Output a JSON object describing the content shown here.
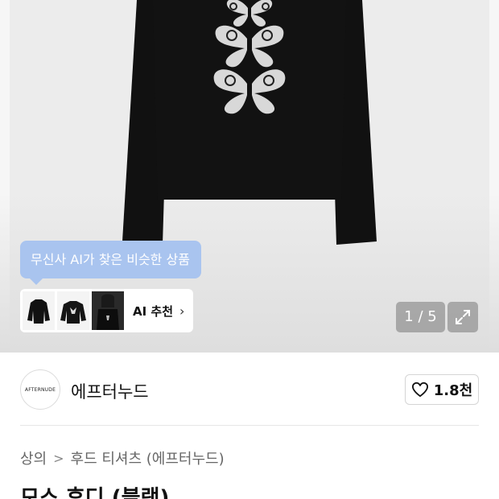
{
  "product_image": {
    "alt": "black long sleeve top with white butterfly print"
  },
  "ai_recommend": {
    "tooltip": "무신사 AI가 찾은 비슷한 상품",
    "label": "AI 추천",
    "chevron": "›"
  },
  "gallery": {
    "counter": "1 / 5",
    "expand_icon": "expand-arrows-icon"
  },
  "brand": {
    "logo_text": "AFTERNUDE",
    "name": "에프터누드"
  },
  "like": {
    "icon": "heart-outline-icon",
    "count": "1.8천"
  },
  "breadcrumb": {
    "items": [
      "상의",
      "후드 티셔츠 (에프터누드)"
    ],
    "separator": ">"
  },
  "product": {
    "title": "모스 후디 (블랙)"
  },
  "colors": {
    "tooltip_bg": "#a9c4ef",
    "hero_bg": "#ececec",
    "overlay": "#787878"
  }
}
